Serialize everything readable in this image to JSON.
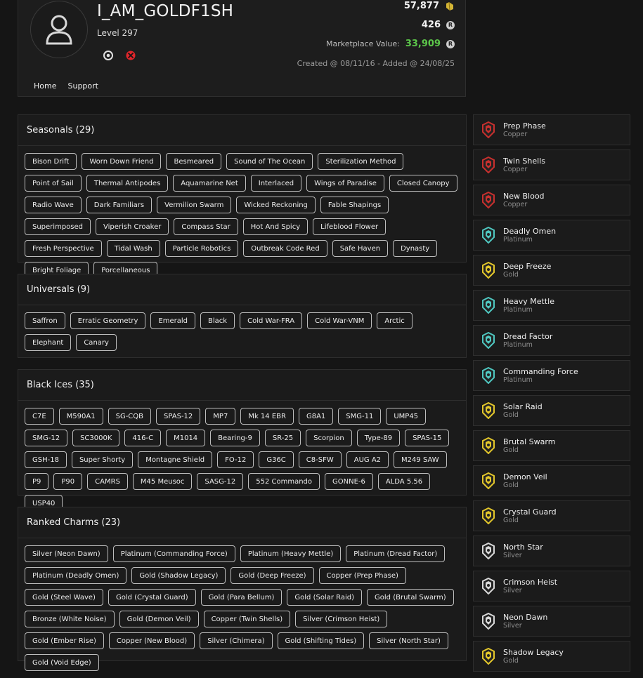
{
  "profile": {
    "username": "I_AM_GOLDF1SH",
    "level": "Level 297",
    "credits": "57,877",
    "renown": "426",
    "market_label": "Marketplace Value:",
    "market_value": "33,909",
    "created": "Created @ 08/11/16 - Added @ 24/08/25",
    "platform_icons": [
      "ubisoft-icon",
      "xbox-icon"
    ],
    "colors": {
      "market_value": "#5cc64a",
      "xbox": "#e0262b"
    }
  },
  "nav": {
    "home": "Home",
    "support": "Support"
  },
  "sections": [
    {
      "title": "Seasonals (29)",
      "items": [
        "Bison Drift",
        "Worn Down Friend",
        "Besmeared",
        "Sound of The Ocean",
        "Sterilization Method",
        "Point of Sail",
        "Thermal Antipodes",
        "Aquamarine Net",
        "Interlaced",
        "Wings of Paradise",
        "Closed Canopy",
        "Radio Wave",
        "Dark Familiars",
        "Vermilion Swarm",
        "Wicked Reckoning",
        "Fable Shapings",
        "Superimposed",
        "Viperish Croaker",
        "Compass Star",
        "Hot And Spicy",
        "Lifeblood Flower",
        "Fresh Perspective",
        "Tidal Wash",
        "Particle Robotics",
        "Outbreak Code Red",
        "Safe Haven",
        "Dynasty",
        "Bright Foliage",
        "Porcellaneous"
      ]
    },
    {
      "title": "Universals (9)",
      "items": [
        "Saffron",
        "Erratic Geometry",
        "Emerald",
        "Black",
        "Cold War-FRA",
        "Cold War-VNM",
        "Arctic",
        "Elephant",
        "Canary"
      ]
    },
    {
      "title": "Black Ices (35)",
      "items": [
        "C7E",
        "M590A1",
        "SG-CQB",
        "SPAS-12",
        "MP7",
        "Mk 14 EBR",
        "G8A1",
        "SMG-11",
        "UMP45",
        "SMG-12",
        "SC3000K",
        "416-C",
        "M1014",
        "Bearing-9",
        "SR-25",
        "Scorpion",
        "Type-89",
        "SPAS-15",
        "GSH-18",
        "Super Shorty",
        "Montagne Shield",
        "FO-12",
        "G36C",
        "C8-SFW",
        "AUG A2",
        "M249 SAW",
        "P9",
        "P90",
        "CAMRS",
        "M45 Meusoc",
        "SASG-12",
        "552 Commando",
        "GONNE-6",
        "ALDA 5.56",
        "USP40"
      ]
    },
    {
      "title": "Ranked Charms (23)",
      "items": [
        "Silver (Neon Dawn)",
        "Platinum (Commanding Force)",
        "Platinum (Heavy Mettle)",
        "Platinum (Dread Factor)",
        "Platinum (Deadly Omen)",
        "Gold (Shadow Legacy)",
        "Gold (Deep Freeze)",
        "Copper (Prep Phase)",
        "Gold (Steel Wave)",
        "Gold (Crystal Guard)",
        "Gold (Para Bellum)",
        "Gold (Solar Raid)",
        "Gold (Brutal Swarm)",
        "Bronze (White Noise)",
        "Gold (Demon Veil)",
        "Copper (Twin Shells)",
        "Silver (Crimson Heist)",
        "Gold (Ember Rise)",
        "Copper (New Blood)",
        "Silver (Chimera)",
        "Gold (Shifting Tides)",
        "Silver (North Star)",
        "Gold (Void Edge)"
      ]
    }
  ],
  "charms": [
    {
      "name": "Prep Phase",
      "tier": "Copper"
    },
    {
      "name": "Twin Shells",
      "tier": "Copper"
    },
    {
      "name": "New Blood",
      "tier": "Copper"
    },
    {
      "name": "Deadly Omen",
      "tier": "Platinum"
    },
    {
      "name": "Deep Freeze",
      "tier": "Gold"
    },
    {
      "name": "Heavy Mettle",
      "tier": "Platinum"
    },
    {
      "name": "Dread Factor",
      "tier": "Platinum"
    },
    {
      "name": "Commanding Force",
      "tier": "Platinum"
    },
    {
      "name": "Solar Raid",
      "tier": "Gold"
    },
    {
      "name": "Brutal Swarm",
      "tier": "Gold"
    },
    {
      "name": "Demon Veil",
      "tier": "Gold"
    },
    {
      "name": "Crystal Guard",
      "tier": "Gold"
    },
    {
      "name": "North Star",
      "tier": "Silver"
    },
    {
      "name": "Crimson Heist",
      "tier": "Silver"
    },
    {
      "name": "Neon Dawn",
      "tier": "Silver"
    },
    {
      "name": "Shadow Legacy",
      "tier": "Gold"
    }
  ],
  "tier_colors": {
    "Copper": "#c8302e",
    "Platinum": "#4fc7c0",
    "Gold": "#e3c72b",
    "Silver": "#d9d9d9"
  }
}
